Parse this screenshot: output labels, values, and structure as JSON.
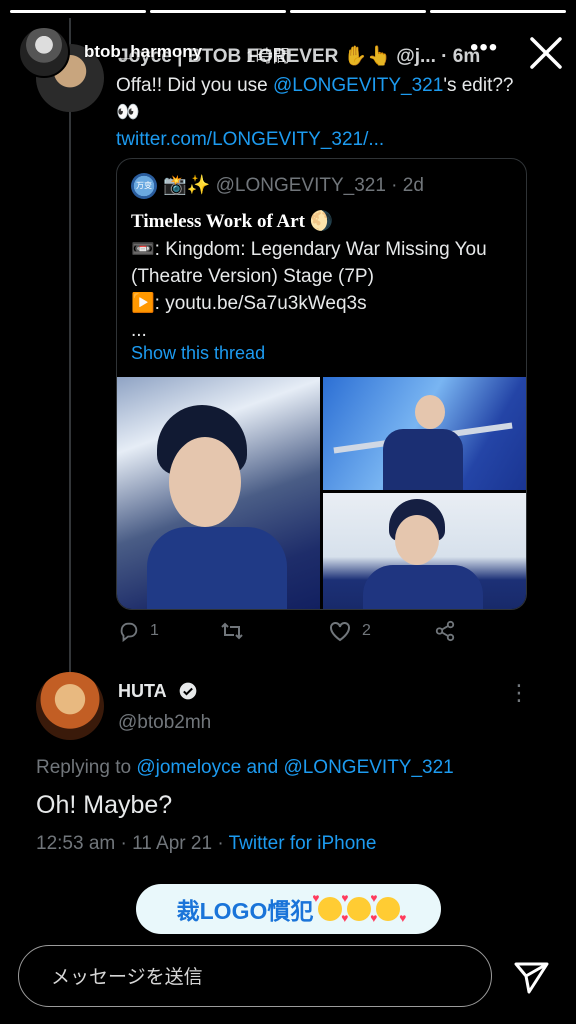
{
  "story": {
    "progress_segments": 4,
    "active_segment": 4,
    "username": "btob_harmony",
    "time": "1時間",
    "more_label": "•••"
  },
  "tweet1": {
    "name": "Joyce | BTOB FOREVER ✋👆 @j... · 6m",
    "text_prefix": "Offa!! Did you use ",
    "text_mention": "@LONGEVITY_321",
    "text_suffix": "'s edit?? 👀",
    "link": "twitter.com/LONGEVITY_321/..."
  },
  "quote": {
    "avatar_text": "万变",
    "header": "📸✨ @LONGEVITY_321 · 2d",
    "title": "Timeless Work of Art 🌖",
    "line1": "📼: Kingdom: Legendary War Missing You (Theatre Version) Stage (7P)",
    "line2": "▶️: youtu.be/Sa7u3kWeq3s",
    "line3": "...",
    "show_thread": "Show this thread"
  },
  "actions": {
    "replies": "1",
    "retweets": "",
    "likes": "2"
  },
  "tweet2": {
    "name": "HUTA",
    "handle": "@btob2mh",
    "more": "⋮",
    "replying_prefix": "Replying to ",
    "replying_to_1": "@jomeloyce",
    "replying_and": " and ",
    "replying_to_2": "@LONGEVITY_321",
    "text": "Oh! Maybe?",
    "meta_time": "12:53 am · 11 Apr 21 · ",
    "meta_client": "Twitter for iPhone"
  },
  "sticker": {
    "text": "裁LOGO慣犯"
  },
  "message": {
    "placeholder": "メッセージを送信"
  },
  "colors": {
    "link": "#1d9bf0",
    "muted": "#71767b",
    "sticker_bg": "#e9f8fb",
    "sticker_text": "#1a74d9"
  }
}
